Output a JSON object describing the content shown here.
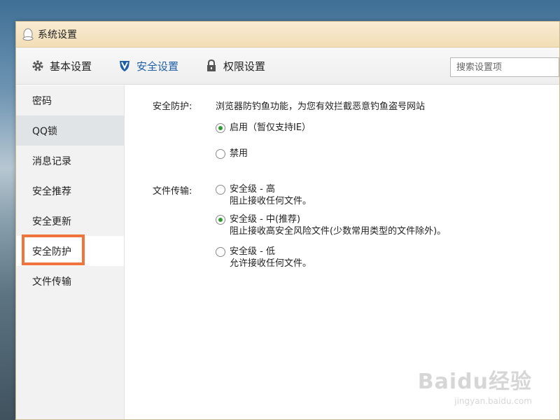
{
  "window": {
    "title": "系统设置"
  },
  "tabs": [
    {
      "label": "基本设置",
      "icon": "gear-icon"
    },
    {
      "label": "安全设置",
      "icon": "shield-icon",
      "active": true
    },
    {
      "label": "权限设置",
      "icon": "lock-icon"
    }
  ],
  "search": {
    "placeholder": "搜索设置项"
  },
  "sidebar": {
    "items": [
      {
        "label": "密码"
      },
      {
        "label": "QQ锁"
      },
      {
        "label": "消息记录"
      },
      {
        "label": "安全推荐"
      },
      {
        "label": "安全更新"
      },
      {
        "label": "安全防护"
      },
      {
        "label": "文件传输"
      }
    ]
  },
  "security_protection": {
    "label": "安全防护:",
    "description": "浏览器防钓鱼功能，为您有效拦截恶意钓鱼盗号网站",
    "options": [
      {
        "label": "启用（暂仅支持IE）",
        "checked": true
      },
      {
        "label": "禁用",
        "checked": false
      }
    ]
  },
  "file_transfer": {
    "label": "文件传输:",
    "options": [
      {
        "label": "安全级 - 高",
        "desc": "阻止接收任何文件。",
        "checked": false
      },
      {
        "label": "安全级 - 中(推荐)",
        "desc": "阻止接收高安全风险文件(少数常用类型的文件除外)。",
        "checked": true
      },
      {
        "label": "安全级 - 低",
        "desc": "允许接收任何文件。",
        "checked": false
      }
    ]
  },
  "watermark": {
    "brand": "Baidu经验",
    "url": "jingyan.baidu.com"
  },
  "colors": {
    "active_tab": "#1f5fa8",
    "radio_checked": "#2e9b2e",
    "highlight": "#f0753c",
    "titlebar": "#f2ddb6"
  }
}
